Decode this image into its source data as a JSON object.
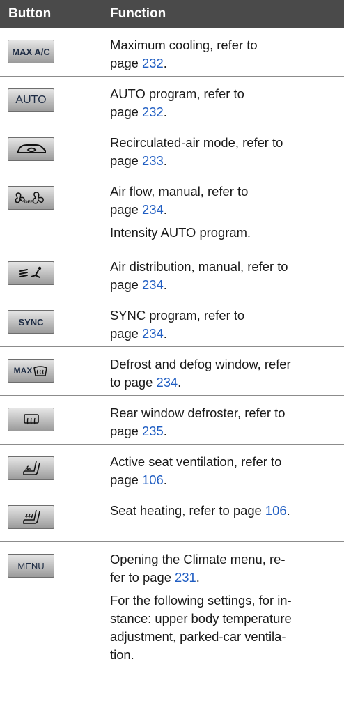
{
  "header": {
    "button": "Button",
    "function": "Function"
  },
  "rows": [
    {
      "icon": "max-ac-icon",
      "button_text": "MAX A/C",
      "lines": [
        "Maximum cooling, refer to",
        "page "
      ],
      "page": "232",
      "suffix": "."
    },
    {
      "icon": "auto-icon",
      "button_text": "AUTO",
      "lines": [
        "AUTO program, refer to",
        "page "
      ],
      "page": "232",
      "suffix": "."
    },
    {
      "icon": "recirculation-icon",
      "lines": [
        "Recirculated-air mode, refer to",
        "page "
      ],
      "page": "233",
      "suffix": "."
    },
    {
      "icon": "fan-icon",
      "lines": [
        "Air flow, manual, refer to",
        "page "
      ],
      "page": "234",
      "suffix": ".",
      "extra": "Intensity AUTO program."
    },
    {
      "icon": "air-distribution-icon",
      "lines": [
        "Air distribution, manual, refer to",
        "page "
      ],
      "page": "234",
      "suffix": "."
    },
    {
      "icon": "sync-icon",
      "button_text": "SYNC",
      "lines": [
        "SYNC program, refer to",
        "page "
      ],
      "page": "234",
      "suffix": "."
    },
    {
      "icon": "max-defrost-icon",
      "button_text": "MAX",
      "lines": [
        "Defrost and defog window, refer",
        "to page "
      ],
      "page": "234",
      "suffix": "."
    },
    {
      "icon": "rear-defroster-icon",
      "lines": [
        "Rear window defroster, refer to",
        "page "
      ],
      "page": "235",
      "suffix": "."
    },
    {
      "icon": "seat-ventilation-icon",
      "lines": [
        "Active seat ventilation, refer to",
        "page "
      ],
      "page": "106",
      "suffix": "."
    },
    {
      "icon": "seat-heating-icon",
      "lines": [
        "Seat heating, refer to page "
      ],
      "page": "106",
      "suffix": "."
    },
    {
      "icon": "menu-icon",
      "button_text": "MENU",
      "lines": [
        "Opening the Climate menu, re-",
        "fer to page "
      ],
      "page": "231",
      "suffix": ".",
      "extra": "For the following settings, for in-\nstance: upper body temperature\nadjustment, parked-car ventila-\ntion."
    }
  ]
}
